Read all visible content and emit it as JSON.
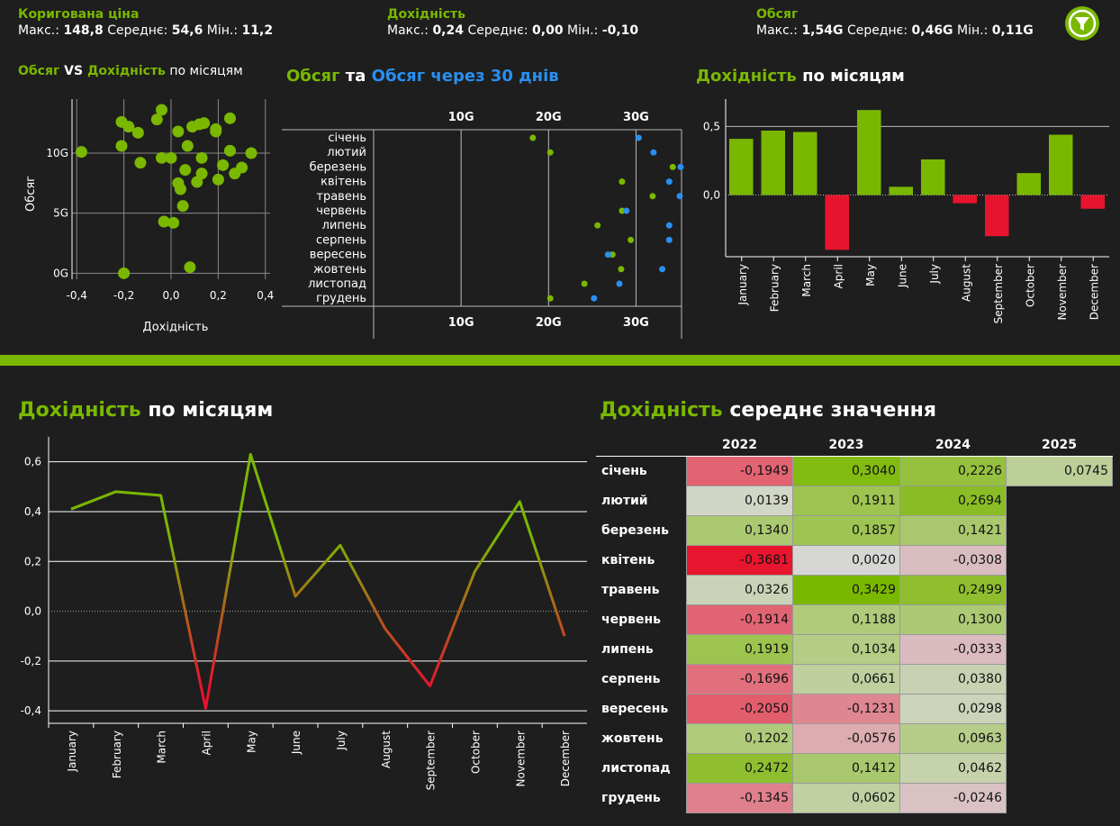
{
  "kpis": [
    {
      "title": "Коригована ціна",
      "max_label": "Макс.:",
      "max": "148,8",
      "avg_label": "Середнє:",
      "avg": "54,6",
      "min_label": "Мін.:",
      "min": "11,2"
    },
    {
      "title": "Дохідність",
      "max_label": "Макс.:",
      "max": "0,24",
      "avg_label": "Середнє:",
      "avg": "0,00",
      "min_label": "Мін.:",
      "min": "-0,10"
    },
    {
      "title": "Обсяг",
      "max_label": "Макс.:",
      "max": "1,54G",
      "avg_label": "Середнє:",
      "avg": "0,46G",
      "min_label": "Мін.:",
      "min": "0,11G"
    }
  ],
  "filter_icon": "filter-icon",
  "titles": {
    "scatter": {
      "a": "Обсяг",
      "b": " VS ",
      "c": "Дохідність",
      "d": " по місяцям"
    },
    "dumbbell": {
      "a": "Обсяг",
      "b": " та ",
      "c": "Обсяг через 30 днів"
    },
    "bar": {
      "a": "Дохідність",
      "b": " по місяцям"
    },
    "line": {
      "a": "Дохідність",
      "b": " по місяцям"
    },
    "heatmap": {
      "a": "Дохідність",
      "b": " середнє значення"
    }
  },
  "colors": {
    "accent": "#7ab800",
    "blue": "#2a8ff0",
    "red": "#e8142d",
    "bg": "#1e1e1e"
  },
  "chart_data": [
    {
      "type": "scatter",
      "xlabel": "Дохідність",
      "ylabel": "Обсяг",
      "xlim": [
        -0.42,
        0.42
      ],
      "ylim": [
        -0.5,
        14.5
      ],
      "xticks": [
        "-0,4",
        "-0,2",
        "0,0",
        "0,2",
        "0,4"
      ],
      "yticks": [
        "0G",
        "5G",
        "10G"
      ],
      "points": [
        [
          -0.38,
          10.1
        ],
        [
          -0.21,
          12.6
        ],
        [
          -0.18,
          12.2
        ],
        [
          -0.21,
          10.6
        ],
        [
          -0.14,
          11.7
        ],
        [
          -0.13,
          9.2
        ],
        [
          -0.06,
          12.8
        ],
        [
          -0.04,
          13.6
        ],
        [
          -0.04,
          9.6
        ],
        [
          -0.03,
          4.3
        ],
        [
          0.0,
          9.6
        ],
        [
          0.01,
          4.2
        ],
        [
          0.03,
          11.8
        ],
        [
          0.03,
          7.5
        ],
        [
          0.04,
          7.0
        ],
        [
          0.05,
          5.6
        ],
        [
          0.06,
          8.6
        ],
        [
          0.07,
          10.6
        ],
        [
          0.08,
          0.5
        ],
        [
          0.09,
          12.2
        ],
        [
          0.11,
          7.6
        ],
        [
          0.12,
          12.4
        ],
        [
          0.13,
          8.3
        ],
        [
          0.13,
          9.6
        ],
        [
          0.14,
          12.5
        ],
        [
          0.19,
          11.8
        ],
        [
          0.19,
          12.0
        ],
        [
          0.2,
          7.8
        ],
        [
          0.22,
          9.0
        ],
        [
          0.25,
          12.9
        ],
        [
          0.25,
          10.2
        ],
        [
          0.27,
          8.3
        ],
        [
          0.3,
          8.8
        ],
        [
          0.34,
          10.0
        ],
        [
          -0.2,
          0.0
        ]
      ]
    },
    {
      "type": "dumbbell",
      "categories": [
        "січень",
        "лютий",
        "березень",
        "квітень",
        "травень",
        "червень",
        "липень",
        "серпень",
        "вересень",
        "жовтень",
        "листопад",
        "грудень"
      ],
      "xticks": [
        "10G",
        "20G",
        "30G"
      ],
      "xlim": [
        0,
        35
      ],
      "start": [
        18.2,
        20.2,
        34.2,
        28.4,
        31.9,
        28.4,
        25.6,
        29.4,
        27.3,
        28.3,
        24.1,
        20.2
      ],
      "end": [
        30.3,
        32.0,
        35.1,
        33.8,
        35.0,
        28.9,
        33.8,
        33.8,
        26.8,
        33.0,
        28.1,
        25.2
      ],
      "start_name": "Обсяг",
      "end_name": "Обсяг через 30 днів"
    },
    {
      "type": "bar",
      "categories": [
        "January",
        "February",
        "March",
        "April",
        "May",
        "June",
        "July",
        "August",
        "September",
        "October",
        "November",
        "December"
      ],
      "values": [
        0.41,
        0.47,
        0.46,
        -0.4,
        0.62,
        0.06,
        0.26,
        -0.06,
        -0.3,
        0.16,
        0.44,
        -0.1
      ],
      "ylim": [
        -0.45,
        0.7
      ],
      "yticks": [
        "0,0",
        "0,5"
      ]
    },
    {
      "type": "line",
      "categories": [
        "January",
        "February",
        "March",
        "April",
        "May",
        "June",
        "July",
        "August",
        "September",
        "October",
        "November",
        "December"
      ],
      "values": [
        0.41,
        0.48,
        0.465,
        -0.39,
        0.63,
        0.06,
        0.265,
        -0.07,
        -0.3,
        0.16,
        0.44,
        -0.1
      ],
      "ylim": [
        -0.45,
        0.7
      ],
      "yticks": [
        "-0,4",
        "-0,2",
        "0,0",
        "0,2",
        "0,4",
        "0,6"
      ]
    },
    {
      "type": "heatmap",
      "columns": [
        "2022",
        "2023",
        "2024",
        "2025"
      ],
      "rows": [
        {
          "label": "січень",
          "values": [
            "-0,1949",
            "0,3040",
            "0,2226",
            "0,0745"
          ]
        },
        {
          "label": "лютий",
          "values": [
            "0,0139",
            "0,1911",
            "0,2694",
            ""
          ]
        },
        {
          "label": "березень",
          "values": [
            "0,1340",
            "0,1857",
            "0,1421",
            ""
          ]
        },
        {
          "label": "квітень",
          "values": [
            "-0,3681",
            "0,0020",
            "-0,0308",
            ""
          ]
        },
        {
          "label": "травень",
          "values": [
            "0,0326",
            "0,3429",
            "0,2499",
            ""
          ]
        },
        {
          "label": "червень",
          "values": [
            "-0,1914",
            "0,1188",
            "0,1300",
            ""
          ]
        },
        {
          "label": "липень",
          "values": [
            "0,1919",
            "0,1034",
            "-0,0333",
            ""
          ]
        },
        {
          "label": "серпень",
          "values": [
            "-0,1696",
            "0,0661",
            "0,0380",
            ""
          ]
        },
        {
          "label": "вересень",
          "values": [
            "-0,2050",
            "-0,1231",
            "0,0298",
            ""
          ]
        },
        {
          "label": "жовтень",
          "values": [
            "0,1202",
            "-0,0576",
            "0,0963",
            ""
          ]
        },
        {
          "label": "листопад",
          "values": [
            "0,2472",
            "0,1412",
            "0,0462",
            ""
          ]
        },
        {
          "label": "грудень",
          "values": [
            "-0,1345",
            "0,0602",
            "-0,0246",
            ""
          ]
        }
      ]
    }
  ]
}
